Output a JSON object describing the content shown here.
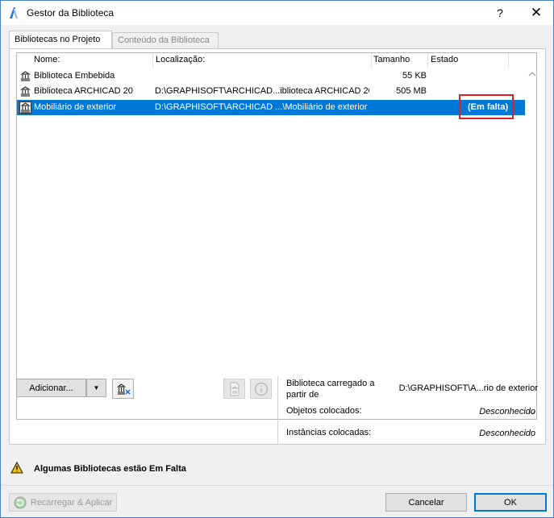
{
  "window": {
    "title": "Gestor da Biblioteca",
    "help_button": "?",
    "close_button": "✕"
  },
  "tabs": [
    {
      "label": "Bibliotecas no Projeto",
      "active": true
    },
    {
      "label": "Conteúdo da Biblioteca",
      "active": false
    }
  ],
  "table": {
    "columns": [
      "Nome:",
      "Localização:",
      "Tamanho",
      "Estado"
    ],
    "rows": [
      {
        "name": "Biblioteca Embebida",
        "location": "",
        "size": "55 KB",
        "status": "",
        "selected": false
      },
      {
        "name": "Biblioteca ARCHICAD 20",
        "location": "D:\\GRAPHISOFT\\ARCHICAD...iblioteca ARCHICAD 20",
        "size": "505 MB",
        "status": "",
        "selected": false
      },
      {
        "name": "Mobiliário de exterior",
        "location": "D:\\GRAPHISOFT\\ARCHICAD ...\\Mobiliário de exterior",
        "size": "",
        "status": "(Em falta)",
        "selected": true
      }
    ]
  },
  "toolbar": {
    "add_label": "Adicionar...",
    "dropdown_arrow": "▼"
  },
  "details": {
    "loaded_from_label": "Biblioteca carregado a partir de",
    "loaded_from_value": "D:\\GRAPHISOFT\\A...rio de exterior",
    "placed_objects_label": "Objetos colocados:",
    "placed_objects_value": "Desconhecido",
    "placed_instances_label": "Instâncias colocadas:",
    "placed_instances_value": "Desconhecido"
  },
  "warning": {
    "text": "Algumas Bibliotecas estão Em Falta"
  },
  "footer": {
    "reload_label": "Recarregar & Aplicar",
    "cancel_label": "Cancelar",
    "ok_label": "OK"
  },
  "colors": {
    "selection": "#0078d7",
    "highlight_box": "#e02020",
    "warning": "#f4c400"
  }
}
